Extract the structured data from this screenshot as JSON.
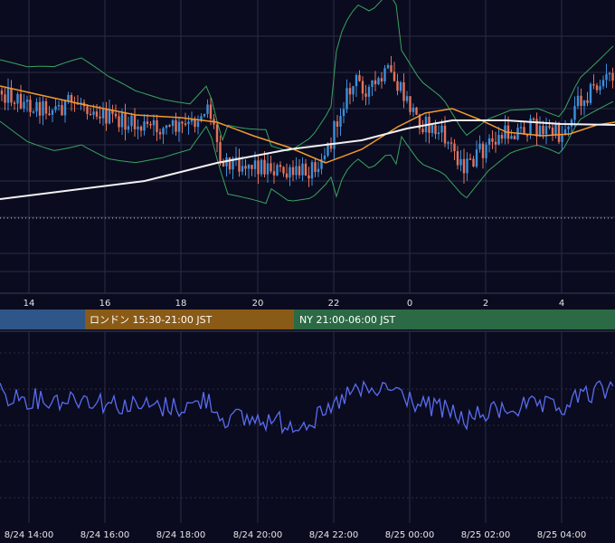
{
  "chart_data": [
    {
      "type": "candlestick",
      "panel": "price",
      "overlays": [
        "bollinger-bands",
        "moving-average-orange",
        "moving-average-white"
      ],
      "x_ticks": [
        "14",
        "16",
        "18",
        "20",
        "22",
        "0",
        "2",
        "4"
      ],
      "grid": true,
      "reference_line": "dotted"
    },
    {
      "type": "line",
      "panel": "oscillator",
      "x_ticks": [
        "8/24 14:00",
        "8/24 16:00",
        "8/24 18:00",
        "8/24 20:00",
        "8/24 22:00",
        "8/25 00:00",
        "8/25 02:00",
        "8/25 04:00"
      ],
      "grid": true
    }
  ],
  "sessions": [
    {
      "label": "",
      "color": "#2f5688"
    },
    {
      "label": "ロンドン 15:30-21:00 JST",
      "color": "#8a5a17"
    },
    {
      "label": "NY 21:00-06:00 JST",
      "color": "#2b6a45"
    }
  ],
  "colors": {
    "background": "#0a0b1f",
    "grid": "#2a2d45",
    "candle_up": "#3d8fdb",
    "candle_down": "#e4735a",
    "bollinger": "#3aa35f",
    "ma_orange": "#f29a2e",
    "ma_white": "#f2f2f2",
    "oscillator": "#5a6cf0"
  }
}
